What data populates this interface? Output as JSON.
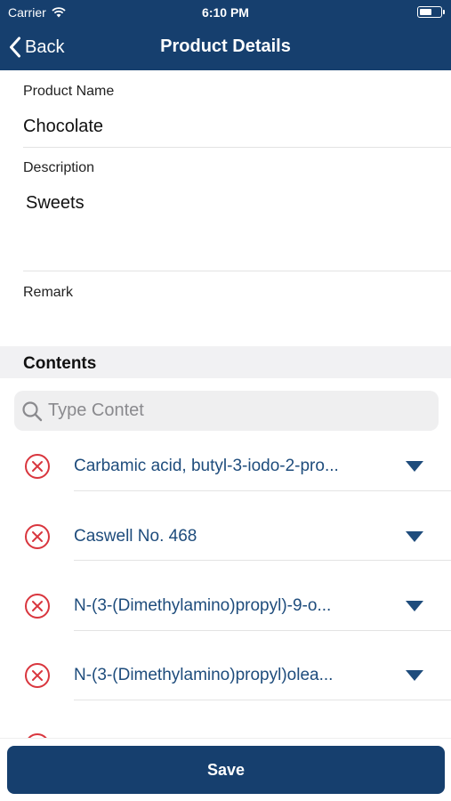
{
  "status_bar": {
    "carrier": "Carrier",
    "time": "6:10 PM",
    "icons": [
      "wifi-icon",
      "battery-icon"
    ]
  },
  "nav": {
    "back_label": "Back",
    "title": "Product Details",
    "background_color": "#163f6e"
  },
  "form": {
    "product_name_label": "Product Name",
    "product_name_value": "Chocolate",
    "description_label": "Description",
    "description_value": "Sweets",
    "remark_label": "Remark",
    "remark_value": ""
  },
  "contents": {
    "title": "Contents",
    "search_placeholder": "Type Contet",
    "items": [
      {
        "label": "Carbamic acid, butyl-3-iodo-2-pro..."
      },
      {
        "label": "Caswell No. 468"
      },
      {
        "label": "N-(3-(Dimethylamino)propyl)-9-o..."
      },
      {
        "label": "N-(3-(Dimethylamino)propyl)olea..."
      }
    ],
    "item_color": "#1e4c7c",
    "remove_icon_color": "#d9363e"
  },
  "footer": {
    "save_label": "Save"
  }
}
